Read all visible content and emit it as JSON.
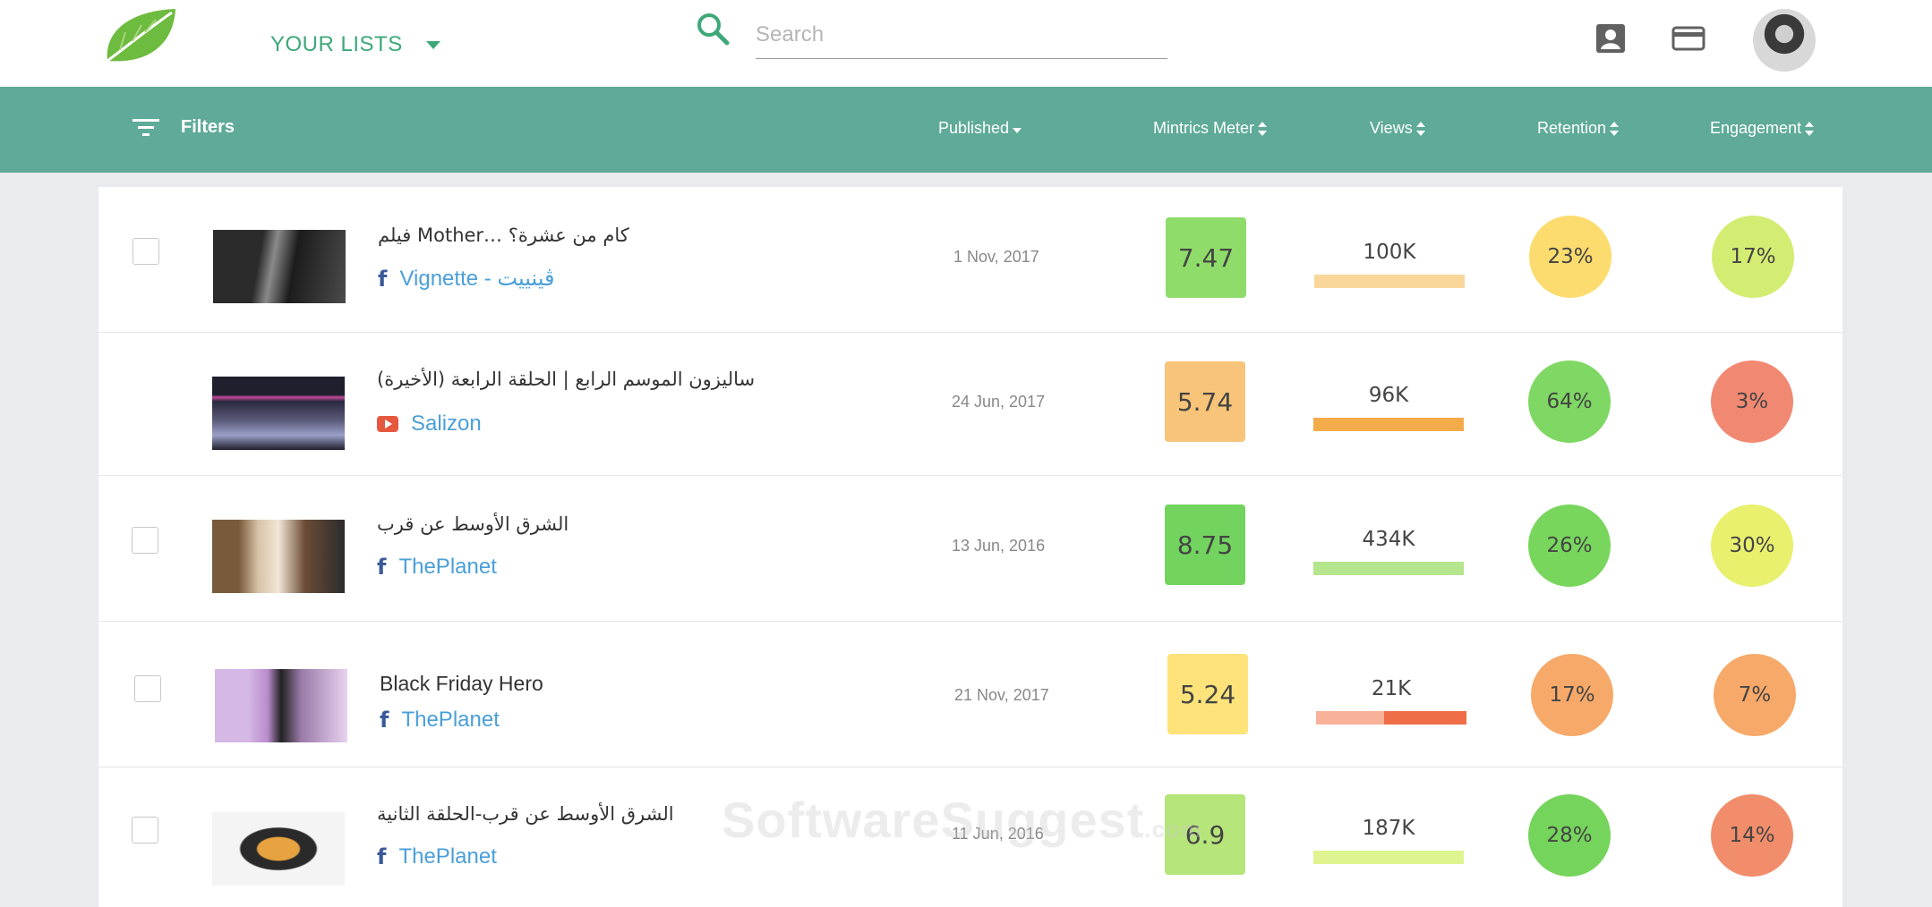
{
  "nav": {
    "lists_label": "YOUR LISTS",
    "search_placeholder": "Search"
  },
  "header": {
    "filters_label": "Filters",
    "columns": [
      "Published",
      "Mintrics Meter",
      "Views",
      "Retention",
      "Engagement"
    ]
  },
  "rows": [
    {
      "title": "فيلم Mother… كام من عشرة؟",
      "source": "Vignette - ڤينييت",
      "platform": "facebook",
      "published": "1 Nov, 2017",
      "meter": "7.47",
      "meter_color": "#8fdc6a",
      "views": "100K",
      "views_fill": [
        {
          "color": "#f9d79a",
          "fraction": 1.0
        }
      ],
      "retention": "23%",
      "retention_color": "#fcdc6e",
      "engagement": "17%",
      "engagement_color": "#d3ec72"
    },
    {
      "title": "(ساليزون الموسم الرابع | الحلقة الرابعة (الأخيرة",
      "source": "Salizon",
      "platform": "youtube",
      "published": "24 Jun, 2017",
      "meter": "5.74",
      "meter_color": "#f7c479",
      "views": "96K",
      "views_fill": [
        {
          "color": "#f4ac4b",
          "fraction": 1.0
        }
      ],
      "retention": "64%",
      "retention_color": "#7ed863",
      "engagement": "3%",
      "engagement_color": "#f18972"
    },
    {
      "title": "الشرق الأوسط عن قرب",
      "source": "ThePlanet",
      "platform": "facebook",
      "published": "13 Jun, 2016",
      "meter": "8.75",
      "meter_color": "#72d45e",
      "views": "434K",
      "views_fill": [
        {
          "color": "#b5e58c",
          "fraction": 1.0
        }
      ],
      "retention": "26%",
      "retention_color": "#78d65d",
      "engagement": "30%",
      "engagement_color": "#e8f06e"
    },
    {
      "title": "Black Friday Hero",
      "source": "ThePlanet",
      "platform": "facebook",
      "published": "21 Nov, 2017",
      "meter": "5.24",
      "meter_color": "#fde37a",
      "views": "21K",
      "views_fill": [
        {
          "color": "#f8b29a",
          "fraction": 0.45
        },
        {
          "color": "#ef6e48",
          "fraction": 0.55
        }
      ],
      "retention": "17%",
      "retention_color": "#f6a969",
      "engagement": "7%",
      "engagement_color": "#f6a969"
    },
    {
      "title": "الشرق الأوسط عن قرب-الحلقة الثانية",
      "source": "ThePlanet",
      "platform": "facebook",
      "published": "11 Jun, 2016",
      "meter": "6.9",
      "meter_color": "#b6e57a",
      "views": "187K",
      "views_fill": [
        {
          "color": "#def490",
          "fraction": 1.0
        }
      ],
      "retention": "28%",
      "retention_color": "#75d45c",
      "engagement": "14%",
      "engagement_color": "#f18d6b"
    }
  ],
  "watermark": {
    "main": "SoftwareSuggest",
    "suffix": ".com"
  }
}
